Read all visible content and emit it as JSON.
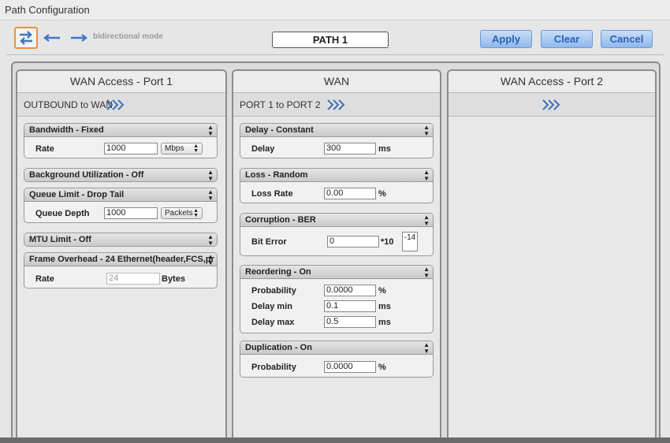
{
  "window": {
    "title": "Path Configuration"
  },
  "toolbar": {
    "mode_label": "bidirectional mode",
    "path_name": "PATH 1",
    "apply_label": "Apply",
    "clear_label": "Clear",
    "cancel_label": "Cancel",
    "accent_color": "#e8913a",
    "button_color": "#2b63b3",
    "icons": [
      "bidirectional-arrows-icon",
      "arrow-left-icon",
      "arrow-right-icon"
    ]
  },
  "columns": [
    {
      "title": "WAN Access - Port 1",
      "subtitle": "OUTBOUND to WAN",
      "panels": [
        {
          "header": "Bandwidth - Fixed",
          "rows": [
            {
              "label": "Rate",
              "value": "1000",
              "unit_select": "Mbps"
            }
          ]
        },
        {
          "header": "Background Utilization - Off"
        },
        {
          "header": "Queue Limit - Drop Tail",
          "rows": [
            {
              "label": "Queue Depth",
              "value": "1000",
              "unit_select": "Packets"
            }
          ]
        },
        {
          "header": "MTU Limit - Off"
        },
        {
          "header": "Frame Overhead - 24 Ethernet(header,FCS,pr",
          "rows": [
            {
              "label": "Rate",
              "value": "24",
              "unit": "Bytes"
            }
          ]
        }
      ]
    },
    {
      "title": "WAN",
      "subtitle": "PORT 1 to PORT 2",
      "panels": [
        {
          "header": "Delay - Constant",
          "rows": [
            {
              "label": "Delay",
              "value": "300",
              "unit": "ms"
            }
          ]
        },
        {
          "header": "Loss - Random",
          "rows": [
            {
              "label": "Loss Rate",
              "value": "0.00",
              "unit": "%"
            }
          ]
        },
        {
          "header": "Corruption - BER",
          "rows": [
            {
              "label": "Bit Error",
              "value": "0",
              "unit": "*10",
              "exponent": "-14"
            }
          ]
        },
        {
          "header": "Reordering - On",
          "rows": [
            {
              "label": "Probability",
              "value": "0.0000",
              "unit": "%"
            },
            {
              "label": "Delay min",
              "value": "0.1",
              "unit": "ms"
            },
            {
              "label": "Delay max",
              "value": "0.5",
              "unit": "ms"
            }
          ]
        },
        {
          "header": "Duplication - On",
          "rows": [
            {
              "label": "Probability",
              "value": "0.0000",
              "unit": "%"
            }
          ]
        }
      ]
    },
    {
      "title": "WAN Access - Port 2",
      "subtitle": ""
    }
  ]
}
